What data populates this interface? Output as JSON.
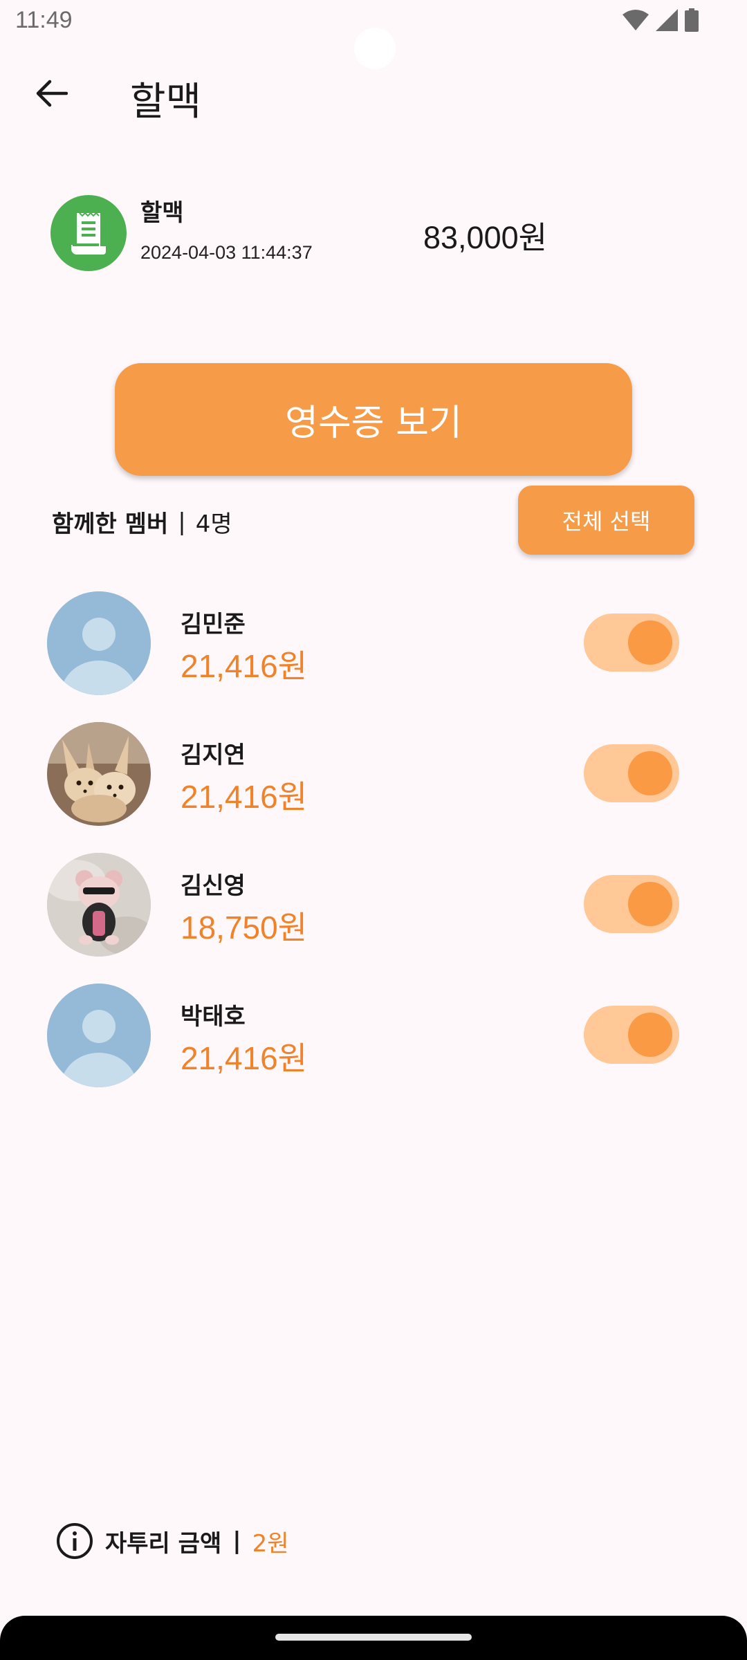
{
  "status_bar": {
    "time": "11:49"
  },
  "app_bar": {
    "title": "할맥"
  },
  "expense": {
    "name": "할맥",
    "datetime": "2024-04-03 11:44:37",
    "amount": "83,000원",
    "icon": "receipt-icon",
    "icon_bg": "#4caf50"
  },
  "receipt_button": {
    "label": "영수증 보기"
  },
  "members_header": {
    "label": "함께한 멤버",
    "separator": "|",
    "count": "4명",
    "select_all_label": "전체 선택"
  },
  "members": [
    {
      "name": "김민준",
      "amount": "21,416원",
      "avatar": "default-avatar",
      "included": true
    },
    {
      "name": "김지연",
      "amount": "21,416원",
      "avatar": "fennec-fox-photo",
      "included": true
    },
    {
      "name": "김신영",
      "amount": "18,750원",
      "avatar": "plush-toy-photo",
      "included": true
    },
    {
      "name": "박태호",
      "amount": "21,416원",
      "avatar": "default-avatar",
      "included": true
    }
  ],
  "remainder": {
    "label": "자투리 금액",
    "separator": "|",
    "value": "2원"
  },
  "colors": {
    "accent": "#f69c48",
    "amount_text": "#f0822a",
    "toggle_track": "#ffc896",
    "toggle_thumb": "#fb9a45",
    "background": "#fff8fb"
  }
}
